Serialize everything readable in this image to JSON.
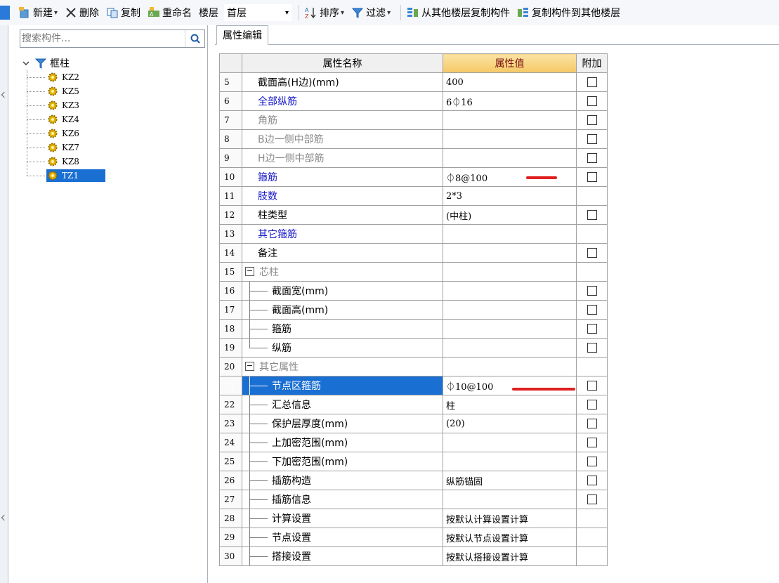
{
  "toolbar": {
    "new_label": "新建",
    "delete_label": "删除",
    "copy_label": "复制",
    "rename_label": "重命名",
    "floor_label": "楼层",
    "floor_value": "首层",
    "sort_label": "排序",
    "filter_label": "过滤",
    "copy_from_other_floor_label": "从其他楼层复制构件",
    "copy_to_other_floor_label": "复制构件到其他楼层"
  },
  "search": {
    "placeholder": "搜索构件..."
  },
  "tree": {
    "root_label": "框柱",
    "items": [
      {
        "label": "KZ2",
        "selected": false
      },
      {
        "label": "KZ5",
        "selected": false
      },
      {
        "label": "KZ3",
        "selected": false
      },
      {
        "label": "KZ4",
        "selected": false
      },
      {
        "label": "KZ6",
        "selected": false
      },
      {
        "label": "KZ7",
        "selected": false
      },
      {
        "label": "KZ8",
        "selected": false
      },
      {
        "label": "TZ1",
        "selected": true
      }
    ]
  },
  "tabs": {
    "property_edit": "属性编辑"
  },
  "grid": {
    "headers": {
      "name": "属性名称",
      "value": "属性值",
      "extra": "附加"
    },
    "rows": [
      {
        "num": "5",
        "name": "截面高(H边)(mm)",
        "value": "400",
        "color": "black",
        "checkbox": true
      },
      {
        "num": "6",
        "name": "全部纵筋",
        "value": "6⏀16",
        "color": "blue",
        "checkbox": true
      },
      {
        "num": "7",
        "name": "角筋",
        "value": "",
        "color": "gray",
        "checkbox": true
      },
      {
        "num": "8",
        "name": "B边一侧中部筋",
        "value": "",
        "color": "gray",
        "checkbox": true
      },
      {
        "num": "9",
        "name": "H边一侧中部筋",
        "value": "",
        "color": "gray",
        "checkbox": true
      },
      {
        "num": "10",
        "name": "箍筋",
        "value": "⏀8@100",
        "color": "blue",
        "checkbox": true
      },
      {
        "num": "11",
        "name": "肢数",
        "value": "2*3",
        "color": "blue",
        "checkbox": false
      },
      {
        "num": "12",
        "name": "柱类型",
        "value": "(中柱)",
        "color": "black",
        "checkbox": true
      },
      {
        "num": "13",
        "name": "其它箍筋",
        "value": "",
        "color": "blue",
        "checkbox": false
      },
      {
        "num": "14",
        "name": "备注",
        "value": "",
        "color": "black",
        "checkbox": true
      },
      {
        "num": "15",
        "name": "芯柱",
        "value": "",
        "color": "gray",
        "checkbox": false
      },
      {
        "num": "16",
        "name": "截面宽(mm)",
        "value": "",
        "color": "black",
        "checkbox": true
      },
      {
        "num": "17",
        "name": "截面高(mm)",
        "value": "",
        "color": "black",
        "checkbox": true
      },
      {
        "num": "18",
        "name": "箍筋",
        "value": "",
        "color": "black",
        "checkbox": true
      },
      {
        "num": "19",
        "name": "纵筋",
        "value": "",
        "color": "black",
        "checkbox": true
      },
      {
        "num": "20",
        "name": "其它属性",
        "value": "",
        "color": "gray",
        "checkbox": false
      },
      {
        "num": "21",
        "name": "节点区箍筋",
        "value": "⏀10@100",
        "color": "black",
        "checkbox": true
      },
      {
        "num": "22",
        "name": "汇总信息",
        "value": "柱",
        "color": "black",
        "checkbox": true
      },
      {
        "num": "23",
        "name": "保护层厚度(mm)",
        "value": "(20)",
        "color": "black",
        "checkbox": true
      },
      {
        "num": "24",
        "name": "上加密范围(mm)",
        "value": "",
        "color": "black",
        "checkbox": true
      },
      {
        "num": "25",
        "name": "下加密范围(mm)",
        "value": "",
        "color": "black",
        "checkbox": true
      },
      {
        "num": "26",
        "name": "插筋构造",
        "value": "纵筋锚固",
        "color": "black",
        "checkbox": true
      },
      {
        "num": "27",
        "name": "插筋信息",
        "value": "",
        "color": "black",
        "checkbox": true
      },
      {
        "num": "28",
        "name": "计算设置",
        "value": "按默认计算设置计算",
        "color": "black",
        "checkbox": false
      },
      {
        "num": "29",
        "name": "节点设置",
        "value": "按默认节点设置计算",
        "color": "black",
        "checkbox": false
      },
      {
        "num": "30",
        "name": "搭接设置",
        "value": "按默认搭接设置计算",
        "color": "black",
        "checkbox": false
      }
    ]
  },
  "colors": {
    "accent": "#1a6fd3",
    "header_value_bg": "#f5c866",
    "annotation_red": "#e02020",
    "name_blue": "#1515c8",
    "name_gray": "#8a8a8a"
  }
}
